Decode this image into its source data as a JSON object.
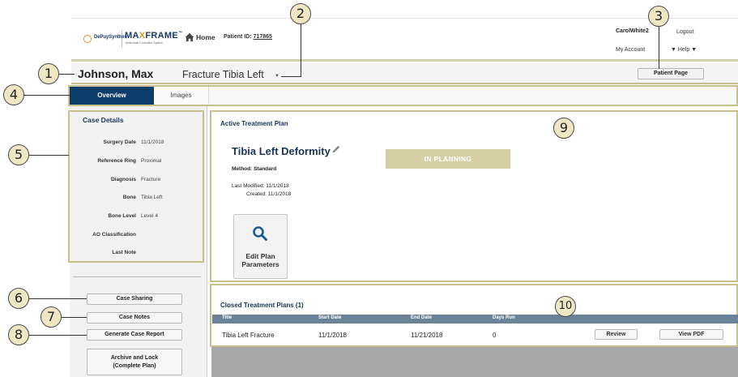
{
  "header": {
    "brand_small": "DePuySynthes",
    "brand_main": "MAXFRAME",
    "brand_main_a": "MA",
    "brand_main_x": "X",
    "brand_main_b": "FRAME",
    "brand_tm": "™",
    "brand_sub": "Multi-Axial Correction System",
    "home_label": "Home",
    "patient_id_label": "Patient ID:",
    "patient_id_value": "717865",
    "user_name": "CarolWhite2",
    "logout_label": "Logout",
    "my_account_label": "My Account",
    "help_label": "▼  Help  ▼"
  },
  "patient_bar": {
    "patient_name": "Johnson, Max",
    "case_select_value": "Fracture Tibia Left",
    "caret": "▼",
    "patient_page_button": "Patient Page"
  },
  "tabs": [
    {
      "label": "Overview",
      "active": true
    },
    {
      "label": "Images",
      "active": false
    }
  ],
  "case_details": {
    "title": "Case Details",
    "rows": [
      {
        "label": "Surgery Date",
        "value": "11/1/2018"
      },
      {
        "label": "Reference Ring",
        "value": "Proximal"
      },
      {
        "label": "Diagnosis",
        "value": "Fracture"
      },
      {
        "label": "Bone",
        "value": "Tibia Left"
      },
      {
        "label": "Bone Level",
        "value": "Level 4"
      },
      {
        "label": "AO Classification",
        "value": ""
      },
      {
        "label": "Last Note",
        "value": ""
      }
    ]
  },
  "side_buttons": {
    "case_sharing": "Case Sharing",
    "case_notes": "Case Notes",
    "generate_report": "Generate Case Report",
    "archive_line1": "Archive and Lock",
    "archive_line2": "(Complete Plan)"
  },
  "active_plan": {
    "section_title": "Active Treatment Plan",
    "plan_name": "Tibia Left Deformity",
    "method": "Method: Standard",
    "last_modified_label": "Last Modified:",
    "last_modified_value": "11/1/2018",
    "created_label": "Created:",
    "created_value": "11/1/2018",
    "status": "IN PLANNING",
    "edit_line1": "Edit Plan",
    "edit_line2": "Parameters"
  },
  "closed_plans": {
    "section_title": "Closed Treatment Plans (1)",
    "columns": [
      "Title",
      "Start Date",
      "End Date",
      "Days Run"
    ],
    "rows": [
      {
        "title": "Tibia Left Fracture",
        "start": "11/1/2018",
        "end": "11/21/2018",
        "days": "0"
      }
    ],
    "review_button": "Review",
    "view_pdf_button": "View PDF"
  },
  "callouts": [
    "1",
    "2",
    "3",
    "4",
    "5",
    "6",
    "7",
    "8",
    "9",
    "10"
  ],
  "colors": {
    "navy": "#0c3c6a",
    "gold_border": "#c8bf8e",
    "status_gold": "#d6cfa6",
    "table_header": "#6a8398",
    "callout_fill": "#efe7c3"
  }
}
